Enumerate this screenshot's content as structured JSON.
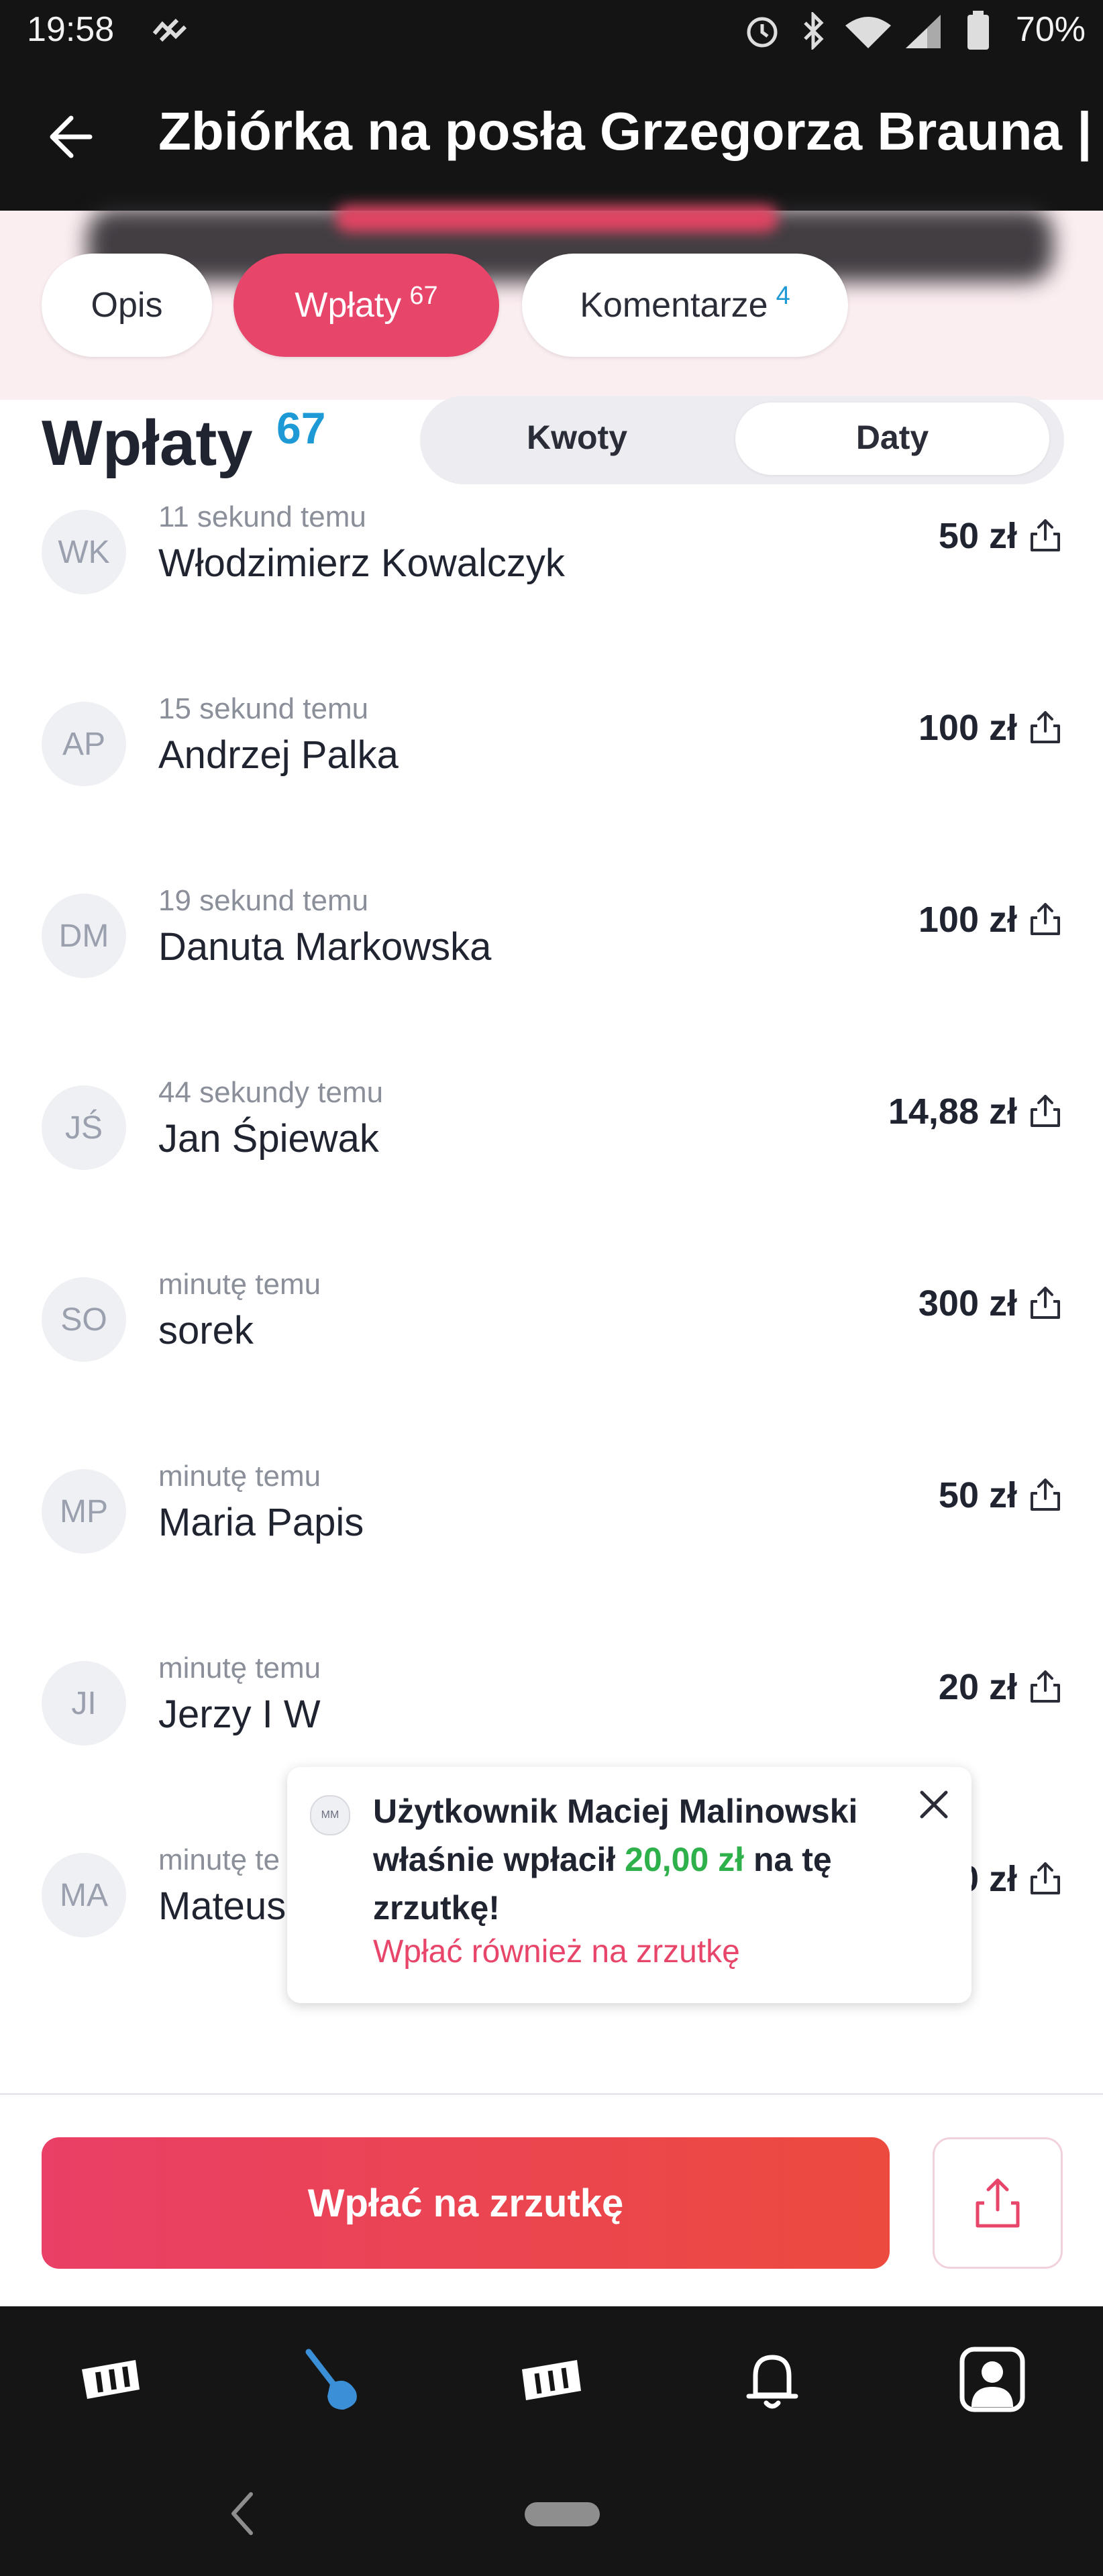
{
  "status_bar": {
    "time": "19:58",
    "battery": "70%"
  },
  "app_bar": {
    "title": "Zbiórka na posła Grzegorza Brauna |..."
  },
  "tabs": [
    {
      "label": "Opis",
      "count": ""
    },
    {
      "label": "Wpłaty",
      "count": "67"
    },
    {
      "label": "Komentarze",
      "count": "4"
    }
  ],
  "section": {
    "title": "Wpłaty",
    "count": "67",
    "sort_options": [
      "Kwoty",
      "Daty"
    ],
    "selected_sort": "Daty"
  },
  "donations": [
    {
      "initials": "WK",
      "time": "11 sekund temu",
      "name": "Włodzimierz Kowalczyk",
      "amount": "50 zł"
    },
    {
      "initials": "AP",
      "time": "15 sekund temu",
      "name": "Andrzej Palka",
      "amount": "100 zł"
    },
    {
      "initials": "DM",
      "time": "19 sekund temu",
      "name": "Danuta Markowska",
      "amount": "100 zł"
    },
    {
      "initials": "JŚ",
      "time": "44 sekundy temu",
      "name": "Jan Śpiewak",
      "amount": "14,88 zł"
    },
    {
      "initials": "SO",
      "time": "minutę temu",
      "name": "sorek",
      "amount": "300 zł"
    },
    {
      "initials": "MP",
      "time": "minutę temu",
      "name": "Maria Papis",
      "amount": "50 zł"
    },
    {
      "initials": "JI",
      "time": "minutę temu",
      "name": "Jerzy I W",
      "amount": "20 zł"
    },
    {
      "initials": "MA",
      "time": "minutę te",
      "name": "Mateus",
      "amount": "0 zł"
    }
  ],
  "toast": {
    "avatar": "MM",
    "line1": "Użytkownik Maciej Malinowski",
    "line2_pre": "właśnie wpłacił ",
    "line2_amount": "20,00 zł",
    "line2_post": " na tę",
    "line3": "zrzutkę!",
    "link": "Wpłać również na zrzutkę"
  },
  "cta": {
    "label": "Wpłać na zrzutkę"
  },
  "colors": {
    "accent": "#e8456a",
    "blue": "#1d9ad6",
    "green": "#2eb04a",
    "dark": "#141414"
  },
  "icons": [
    "back-arrow-icon",
    "share-icon",
    "close-icon",
    "logo-icon",
    "shovel-icon",
    "gift-icon",
    "bell-icon",
    "profile-icon"
  ]
}
